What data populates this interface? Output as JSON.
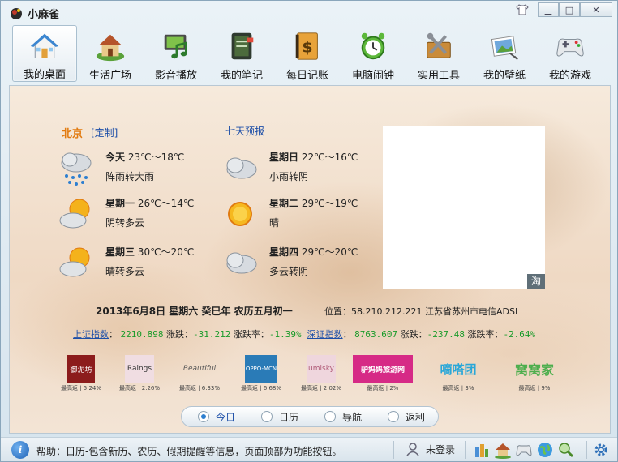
{
  "app": {
    "title": "小麻雀"
  },
  "toolbar": [
    {
      "label": "我的桌面",
      "icon": "house-icon",
      "active": true
    },
    {
      "label": "生活广场",
      "icon": "cottage-icon"
    },
    {
      "label": "影音播放",
      "icon": "film-music-icon"
    },
    {
      "label": "我的笔记",
      "icon": "notebook-icon"
    },
    {
      "label": "每日记账",
      "icon": "ledger-dollar-icon"
    },
    {
      "label": "电脑闹钟",
      "icon": "alarm-clock-icon"
    },
    {
      "label": "实用工具",
      "icon": "toolbox-icon"
    },
    {
      "label": "我的壁纸",
      "icon": "wallpaper-icon"
    },
    {
      "label": "我的游戏",
      "icon": "gamepad-icon"
    }
  ],
  "weather": {
    "city": "北京",
    "customize": "[定制]",
    "forecast_link": "七天预报",
    "days": [
      {
        "day": "今天",
        "temp": "23℃～18℃",
        "desc": "阵雨转大雨",
        "icon": "rain-cloud-icon"
      },
      {
        "day": "星期日",
        "temp": "22℃～16℃",
        "desc": "小雨转阴",
        "icon": "cloud-icon"
      },
      {
        "day": "星期一",
        "temp": "26℃～14℃",
        "desc": "阴转多云",
        "icon": "sun-cloud-icon"
      },
      {
        "day": "星期二",
        "temp": "29℃～19℃",
        "desc": "晴",
        "icon": "sun-icon"
      },
      {
        "day": "星期三",
        "temp": "30℃～20℃",
        "desc": "晴转多云",
        "icon": "sun-cloud-icon"
      },
      {
        "day": "星期四",
        "temp": "29℃～20℃",
        "desc": "多云转阴",
        "icon": "cloud-icon"
      }
    ]
  },
  "ad": {
    "badge": "淘"
  },
  "date_line": "2013年6月8日  星期六  癸巳年  农历五月初一",
  "location": "位置：58.210.212.221 江苏省苏州市电信ADSL",
  "stocks": {
    "sh_label": "上证指数",
    "sh_value": "2210.898",
    "change_label": "涨跌：",
    "sh_change": "-31.212",
    "rate_label": "涨跌率：",
    "sh_rate": "-1.39%",
    "sz_label": "深证指数",
    "sz_value": "8763.607",
    "sz_change": "-237.48",
    "sz_rate": "-2.64%"
  },
  "brands": [
    {
      "name": "御泥坊",
      "note": "最高返 | 5.24%",
      "color": "#8c1c1c"
    },
    {
      "name": "Raings",
      "note": "最高返 | 2.26%",
      "color": "#c98a9a"
    },
    {
      "name": "Beautiful",
      "note": "最高返 | 6.33%",
      "color": "#555555"
    },
    {
      "name": "OPPO-MCN",
      "note": "最高返 | 6.68%",
      "color": "#2a7bb7"
    },
    {
      "name": "umisky",
      "note": "最高返 | 2.02%",
      "color": "#b05a78"
    },
    {
      "name": "驴妈妈旅游网",
      "note": "最高返 | 2%",
      "color": "#d62a86"
    },
    {
      "name": "嘀嗒团",
      "note": "最高返 | 3%",
      "color": "#2aa7d8"
    },
    {
      "name": "窝窝家",
      "note": "最高返 | 9%",
      "color": "#4cae4c"
    }
  ],
  "tabs": [
    {
      "label": "今日",
      "active": true
    },
    {
      "label": "日历"
    },
    {
      "label": "导航"
    },
    {
      "label": "返利"
    }
  ],
  "status": {
    "help": "帮助：日历-包含新历、农历、假期提醒等信息，页面顶部为功能按钮。",
    "login": "未登录"
  },
  "colors": {
    "accent": "#2d7fd0",
    "city": "#e27b10",
    "link": "#1d4fa8",
    "stock": "#1a9b2a"
  }
}
